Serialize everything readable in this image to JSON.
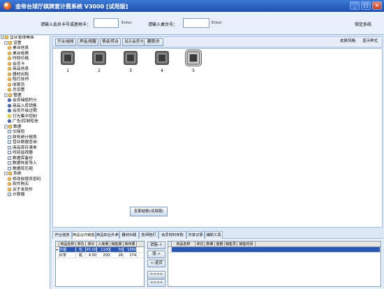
{
  "window": {
    "title": "金帝台球厅棋牌室计费系统 V3000 [试用版]",
    "buttons": [
      "_",
      "□",
      "×"
    ]
  },
  "topbar": {
    "member_label": "请输入会员卡号或者刷卡：",
    "member_input": "",
    "enter1": "Enter",
    "table_label": "请输入桌台号：",
    "table_input": "",
    "enter2": "Enter",
    "lock": "锁定系统"
  },
  "sidebar": {
    "items": [
      {
        "label": "营业管理桌面",
        "level": 0,
        "icon": "folder-icon"
      },
      {
        "label": "设置",
        "level": 1,
        "icon": "folder-icon"
      },
      {
        "label": "桌台信息",
        "level": 2,
        "icon": "circle-icon"
      },
      {
        "label": "桌台收费",
        "level": 2,
        "icon": "circle-icon"
      },
      {
        "label": "时段价格",
        "level": 2,
        "icon": "circle-icon"
      },
      {
        "label": "会员卡",
        "level": 2,
        "icon": "circle-icon"
      },
      {
        "label": "商品信息",
        "level": 2,
        "icon": "circle-icon"
      },
      {
        "label": "器材出租",
        "level": 2,
        "icon": "circle-icon"
      },
      {
        "label": "陪打技师",
        "level": 2,
        "icon": "circle-icon"
      },
      {
        "label": "收银员",
        "level": 2,
        "icon": "circle-icon"
      },
      {
        "label": "总设置",
        "level": 2,
        "icon": "circle-icon"
      },
      {
        "label": "管理",
        "level": 1,
        "icon": "folder-icon"
      },
      {
        "label": "会员储值积分",
        "level": 2,
        "icon": "person-icon"
      },
      {
        "label": "商品入库销售",
        "level": 2,
        "icon": "person-icon"
      },
      {
        "label": "会员升级过期",
        "level": 2,
        "icon": "person-icon"
      },
      {
        "label": "灯光集中控制",
        "level": 2,
        "icon": "bulb-icon"
      },
      {
        "label": "广告/控制短信",
        "level": 2,
        "icon": "person-icon"
      },
      {
        "label": "数据",
        "level": 1,
        "icon": "folder-icon"
      },
      {
        "label": "交接班",
        "level": 2,
        "icon": "sheet-icon"
      },
      {
        "label": "财务统计报表",
        "level": 2,
        "icon": "sheet-icon"
      },
      {
        "label": "营业数据查询",
        "level": 2,
        "icon": "sheet-icon"
      },
      {
        "label": "商品库存清单",
        "level": 2,
        "icon": "sheet-icon"
      },
      {
        "label": "时间监视器",
        "level": 2,
        "icon": "sheet-icon"
      },
      {
        "label": "数据库备份",
        "level": 2,
        "icon": "sheet-icon"
      },
      {
        "label": "数据恢复导入",
        "level": 2,
        "icon": "sheet-icon"
      },
      {
        "label": "数据库压缩",
        "level": 2,
        "icon": "sheet-icon"
      },
      {
        "label": "系统",
        "level": 1,
        "icon": "folder-icon"
      },
      {
        "label": "修改收银员密码",
        "level": 2,
        "icon": "circle-icon"
      },
      {
        "label": "软件购买",
        "level": 2,
        "icon": "circle-icon"
      },
      {
        "label": "关于本软件",
        "level": 2,
        "icon": "circle-icon"
      },
      {
        "label": "计算器",
        "level": 2,
        "icon": "sheet-icon"
      }
    ]
  },
  "toolbar": {
    "buttons": [
      "开台/结帐",
      "押金/提醒",
      "换桌/转台",
      "出示会员卡",
      "翻牌/扑"
    ],
    "right": [
      "皮肤风格",
      "显示样式"
    ]
  },
  "tables": [
    {
      "num": "1"
    },
    {
      "num": "2"
    },
    {
      "num": "3"
    },
    {
      "num": "4"
    },
    {
      "num": "5"
    }
  ],
  "all_tables_button": "全部结帐(试用版)",
  "tabs": [
    "开台信息",
    "商品台内销售",
    "商品如台外卖",
    "器材出租",
    "技师陪打",
    "会员材料存取",
    "共享记录",
    "辅助工具"
  ],
  "orders_table": {
    "headers": [
      "商品名称",
      "单位",
      "单价",
      "入库量",
      "销售量",
      "库存量"
    ],
    "rows": [
      [
        "外烟",
        "包",
        "45.00",
        "1100",
        "50",
        "1050"
      ],
      [
        "红茶",
        "瓶",
        "4.00",
        "200",
        "26",
        "174"
      ]
    ]
  },
  "move_buttons": [
    "销售->",
    "增->",
    "<-退货",
    ">>>>",
    "<<<<"
  ],
  "detail_table": {
    "headers": [
      "商品名称",
      "单位",
      "数量",
      "金额",
      "销售员",
      "销售时间"
    ]
  }
}
